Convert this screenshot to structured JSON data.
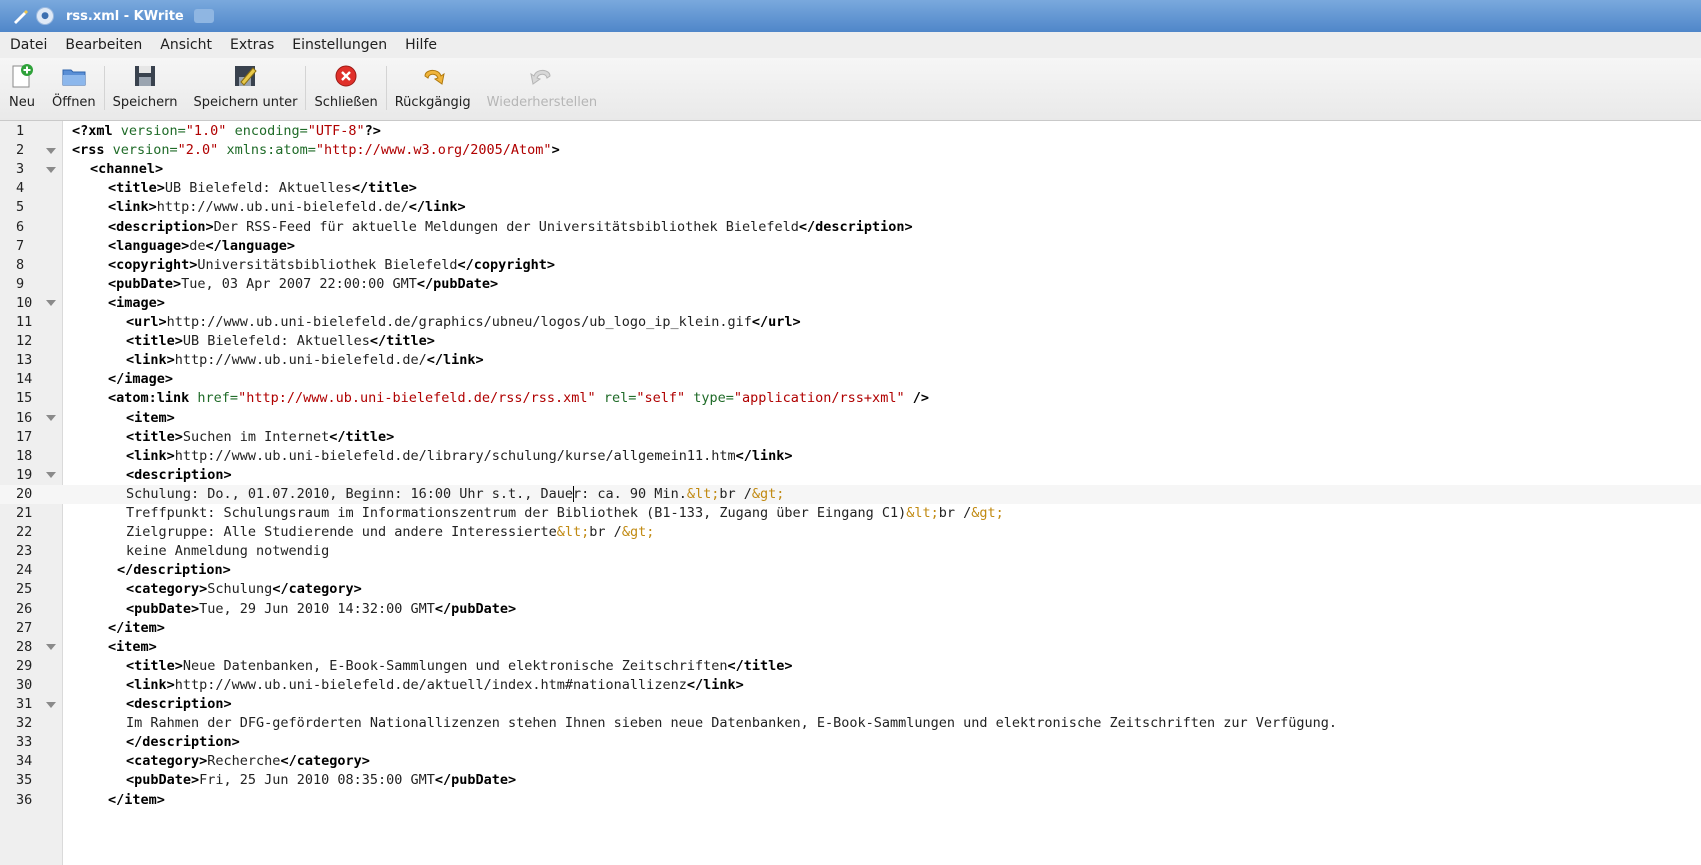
{
  "window": {
    "title": "rss.xml - KWrite"
  },
  "menu": [
    "Datei",
    "Bearbeiten",
    "Ansicht",
    "Extras",
    "Einstellungen",
    "Hilfe"
  ],
  "toolbar": {
    "new_label": "Neu",
    "open_label": "Öffnen",
    "save_label": "Speichern",
    "save_as_label": "Speichern unter",
    "close_label": "Schließen",
    "undo_label": "Rückgängig",
    "redo_label": "Wiederherstellen"
  },
  "editor": {
    "current_line": 20,
    "lines": [
      {
        "n": "1",
        "fold": false,
        "indent": 0,
        "segs": [
          [
            "pi",
            "<?xml"
          ],
          [
            "attr",
            " version="
          ],
          [
            "val",
            "\"1.0\""
          ],
          [
            "attr",
            " encoding="
          ],
          [
            "val",
            "\"UTF-8\""
          ],
          [
            "pi",
            "?>"
          ]
        ]
      },
      {
        "n": "2",
        "fold": true,
        "indent": 0,
        "segs": [
          [
            "tag",
            "<rss"
          ],
          [
            "attr",
            " version="
          ],
          [
            "val",
            "\"2.0\""
          ],
          [
            "attr",
            " xmlns:atom="
          ],
          [
            "val",
            "\"http://www.w3.org/2005/Atom\""
          ],
          [
            "tag",
            ">"
          ]
        ]
      },
      {
        "n": "3",
        "fold": true,
        "indent": 2,
        "segs": [
          [
            "tag",
            "<channel>"
          ]
        ]
      },
      {
        "n": "4",
        "fold": false,
        "indent": 4,
        "segs": [
          [
            "tag",
            "<title>"
          ],
          [
            "txt",
            "UB Bielefeld: Aktuelles"
          ],
          [
            "tag",
            "</title>"
          ]
        ]
      },
      {
        "n": "5",
        "fold": false,
        "indent": 4,
        "segs": [
          [
            "tag",
            "<link>"
          ],
          [
            "txt",
            "http://www.ub.uni-bielefeld.de/"
          ],
          [
            "tag",
            "</link>"
          ]
        ]
      },
      {
        "n": "6",
        "fold": false,
        "indent": 4,
        "segs": [
          [
            "tag",
            "<description>"
          ],
          [
            "txt",
            "Der RSS-Feed für aktuelle Meldungen der Universitätsbibliothek Bielefeld"
          ],
          [
            "tag",
            "</description>"
          ]
        ]
      },
      {
        "n": "7",
        "fold": false,
        "indent": 4,
        "segs": [
          [
            "tag",
            "<language>"
          ],
          [
            "txt",
            "de"
          ],
          [
            "tag",
            "</language>"
          ]
        ]
      },
      {
        "n": "8",
        "fold": false,
        "indent": 4,
        "segs": [
          [
            "tag",
            "<copyright>"
          ],
          [
            "txt",
            "Universitätsbibliothek Bielefeld"
          ],
          [
            "tag",
            "</copyright>"
          ]
        ]
      },
      {
        "n": "9",
        "fold": false,
        "indent": 4,
        "segs": [
          [
            "tag",
            "<pubDate>"
          ],
          [
            "txt",
            "Tue, 03 Apr 2007 22:00:00 GMT"
          ],
          [
            "tag",
            "</pubDate>"
          ]
        ]
      },
      {
        "n": "10",
        "fold": true,
        "indent": 4,
        "segs": [
          [
            "tag",
            "<image>"
          ]
        ]
      },
      {
        "n": "11",
        "fold": false,
        "indent": 6,
        "segs": [
          [
            "tag",
            "<url>"
          ],
          [
            "txt",
            "http://www.ub.uni-bielefeld.de/graphics/ubneu/logos/ub_logo_ip_klein.gif"
          ],
          [
            "tag",
            "</url>"
          ]
        ]
      },
      {
        "n": "12",
        "fold": false,
        "indent": 6,
        "segs": [
          [
            "tag",
            "<title>"
          ],
          [
            "txt",
            "UB Bielefeld: Aktuelles"
          ],
          [
            "tag",
            "</title>"
          ]
        ]
      },
      {
        "n": "13",
        "fold": false,
        "indent": 6,
        "segs": [
          [
            "tag",
            "<link>"
          ],
          [
            "txt",
            "http://www.ub.uni-bielefeld.de/"
          ],
          [
            "tag",
            "</link>"
          ]
        ]
      },
      {
        "n": "14",
        "fold": false,
        "indent": 4,
        "segs": [
          [
            "tag",
            "</image>"
          ]
        ]
      },
      {
        "n": "15",
        "fold": false,
        "indent": 4,
        "segs": [
          [
            "tag",
            "<atom:link"
          ],
          [
            "attr",
            " href="
          ],
          [
            "val",
            "\"http://www.ub.uni-bielefeld.de/rss/rss.xml\""
          ],
          [
            "attr",
            " rel="
          ],
          [
            "val",
            "\"self\""
          ],
          [
            "attr",
            " type="
          ],
          [
            "val",
            "\"application/rss+xml\""
          ],
          [
            "tag",
            " />"
          ]
        ]
      },
      {
        "n": "16",
        "fold": true,
        "indent": 6,
        "segs": [
          [
            "tag",
            "<item>"
          ]
        ]
      },
      {
        "n": "17",
        "fold": false,
        "indent": 6,
        "segs": [
          [
            "tag",
            "<title>"
          ],
          [
            "txt",
            "Suchen im Internet"
          ],
          [
            "tag",
            "</title>"
          ]
        ]
      },
      {
        "n": "18",
        "fold": false,
        "indent": 6,
        "segs": [
          [
            "tag",
            "<link>"
          ],
          [
            "txt",
            "http://www.ub.uni-bielefeld.de/library/schulung/kurse/allgemein11.htm"
          ],
          [
            "tag",
            "</link>"
          ]
        ]
      },
      {
        "n": "19",
        "fold": true,
        "indent": 6,
        "segs": [
          [
            "tag",
            "<description>"
          ]
        ]
      },
      {
        "n": "20",
        "fold": false,
        "indent": 6,
        "segs": [
          [
            "txt",
            "Schulung: Do., 01.07.2010, Beginn: 16:00 Uhr s.t., Daue"
          ],
          [
            "caret",
            ""
          ],
          [
            "txt",
            "r: ca. 90 Min."
          ],
          [
            "ent",
            "&lt;"
          ],
          [
            "txt",
            "br /"
          ],
          [
            "ent",
            "&gt;"
          ]
        ]
      },
      {
        "n": "21",
        "fold": false,
        "indent": 6,
        "segs": [
          [
            "txt",
            "Treffpunkt: Schulungsraum im Informationszentrum der Bibliothek (B1-133, Zugang über Eingang C1)"
          ],
          [
            "ent",
            "&lt;"
          ],
          [
            "txt",
            "br /"
          ],
          [
            "ent",
            "&gt;"
          ]
        ]
      },
      {
        "n": "22",
        "fold": false,
        "indent": 6,
        "segs": [
          [
            "txt",
            "Zielgruppe: Alle Studierende und andere Interessierte"
          ],
          [
            "ent",
            "&lt;"
          ],
          [
            "txt",
            "br /"
          ],
          [
            "ent",
            "&gt;"
          ]
        ]
      },
      {
        "n": "23",
        "fold": false,
        "indent": 6,
        "segs": [
          [
            "txt",
            "keine Anmeldung notwendig"
          ]
        ]
      },
      {
        "n": "24",
        "fold": false,
        "indent": 5,
        "segs": [
          [
            "tag",
            "</description>"
          ]
        ]
      },
      {
        "n": "25",
        "fold": false,
        "indent": 6,
        "segs": [
          [
            "tag",
            "<category>"
          ],
          [
            "txt",
            "Schulung"
          ],
          [
            "tag",
            "</category>"
          ]
        ]
      },
      {
        "n": "26",
        "fold": false,
        "indent": 6,
        "segs": [
          [
            "tag",
            "<pubDate>"
          ],
          [
            "txt",
            "Tue, 29 Jun 2010 14:32:00 GMT"
          ],
          [
            "tag",
            "</pubDate>"
          ]
        ]
      },
      {
        "n": "27",
        "fold": false,
        "indent": 4,
        "segs": [
          [
            "tag",
            "</item>"
          ]
        ]
      },
      {
        "n": "28",
        "fold": true,
        "indent": 4,
        "segs": [
          [
            "tag",
            "<item>"
          ]
        ]
      },
      {
        "n": "29",
        "fold": false,
        "indent": 6,
        "segs": [
          [
            "tag",
            "<title>"
          ],
          [
            "txt",
            "Neue Datenbanken, E-Book-Sammlungen und elektronische Zeitschriften"
          ],
          [
            "tag",
            "</title>"
          ]
        ]
      },
      {
        "n": "30",
        "fold": false,
        "indent": 6,
        "segs": [
          [
            "tag",
            "<link>"
          ],
          [
            "txt",
            "http://www.ub.uni-bielefeld.de/aktuell/index.htm#nationallizenz"
          ],
          [
            "tag",
            "</link>"
          ]
        ]
      },
      {
        "n": "31",
        "fold": true,
        "indent": 6,
        "segs": [
          [
            "tag",
            "<description>"
          ]
        ]
      },
      {
        "n": "32",
        "fold": false,
        "indent": 6,
        "segs": [
          [
            "txt",
            "Im Rahmen der DFG-geförderten Nationallizenzen stehen Ihnen sieben neue Datenbanken, E-Book-Sammlungen und elektronische Zeitschriften zur Verfügung."
          ]
        ]
      },
      {
        "n": "33",
        "fold": false,
        "indent": 6,
        "segs": [
          [
            "tag",
            "</description>"
          ]
        ]
      },
      {
        "n": "34",
        "fold": false,
        "indent": 6,
        "segs": [
          [
            "tag",
            "<category>"
          ],
          [
            "txt",
            "Recherche"
          ],
          [
            "tag",
            "</category>"
          ]
        ]
      },
      {
        "n": "35",
        "fold": false,
        "indent": 6,
        "segs": [
          [
            "tag",
            "<pubDate>"
          ],
          [
            "txt",
            "Fri, 25 Jun 2010 08:35:00 GMT"
          ],
          [
            "tag",
            "</pubDate>"
          ]
        ]
      },
      {
        "n": "36",
        "fold": false,
        "indent": 4,
        "segs": [
          [
            "tag",
            "</item>"
          ]
        ]
      }
    ]
  }
}
